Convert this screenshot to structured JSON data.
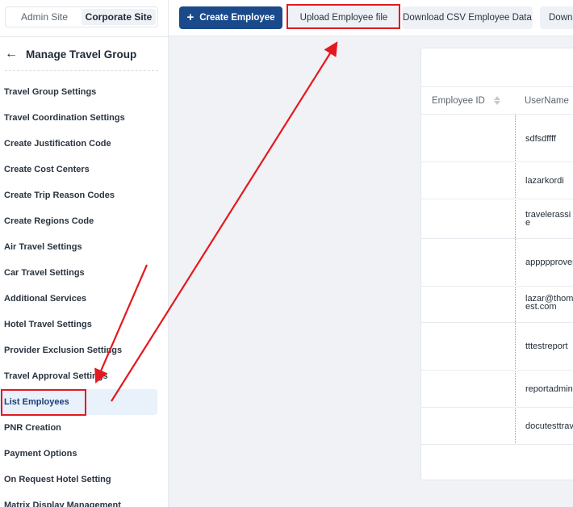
{
  "site_switch": {
    "tabs": [
      {
        "label": "Admin Site",
        "active": false
      },
      {
        "label": "Corporate Site",
        "active": true
      }
    ]
  },
  "sidebar": {
    "back_icon": "arrow-left-icon",
    "title": "Manage Travel Group",
    "items": [
      {
        "label": "Travel Group Settings"
      },
      {
        "label": "Travel Coordination Settings"
      },
      {
        "label": "Create Justification Code"
      },
      {
        "label": "Create Cost Centers"
      },
      {
        "label": "Create Trip Reason Codes"
      },
      {
        "label": "Create Regions Code"
      },
      {
        "label": "Air Travel Settings"
      },
      {
        "label": "Car Travel Settings"
      },
      {
        "label": "Additional Services"
      },
      {
        "label": "Hotel Travel Settings"
      },
      {
        "label": "Provider Exclusion Settings"
      },
      {
        "label": "Travel Approval Settings"
      },
      {
        "label": "List Employees",
        "active": true
      },
      {
        "label": "PNR Creation"
      },
      {
        "label": "Payment Options"
      },
      {
        "label": "On Request Hotel Setting"
      },
      {
        "label": "Matrix Display Management"
      }
    ]
  },
  "toolbar": {
    "create_label": "Create Employee",
    "create_icon": "plus-icon",
    "upload_label": "Upload Employee file",
    "csv_label": "Download CSV Employee Data",
    "download_label": "Downl"
  },
  "table": {
    "columns": [
      {
        "label": "Employee ID",
        "sortable": true
      },
      {
        "label": "UserName"
      }
    ],
    "rows": [
      {
        "employee_id": "",
        "username_lines": [
          "sdfsdffff"
        ]
      },
      {
        "employee_id": "",
        "username_lines": [
          "lazarkordi"
        ]
      },
      {
        "employee_id": "",
        "username_lines": [
          "travelerassi",
          "e"
        ]
      },
      {
        "employee_id": "",
        "username_lines": [
          "appppprover"
        ]
      },
      {
        "employee_id": "",
        "username_lines": [
          "lazar@thom",
          "est.com"
        ]
      },
      {
        "employee_id": "",
        "username_lines": [
          "tttestreport"
        ]
      },
      {
        "employee_id": "",
        "username_lines": [
          "reportadmin"
        ]
      },
      {
        "employee_id": "",
        "username_lines": [
          "docutesttrav"
        ]
      }
    ]
  },
  "colors": {
    "primary": "#1a4a8a",
    "annotation": "#e3191f",
    "active_item_bg": "#e9f1fb"
  }
}
